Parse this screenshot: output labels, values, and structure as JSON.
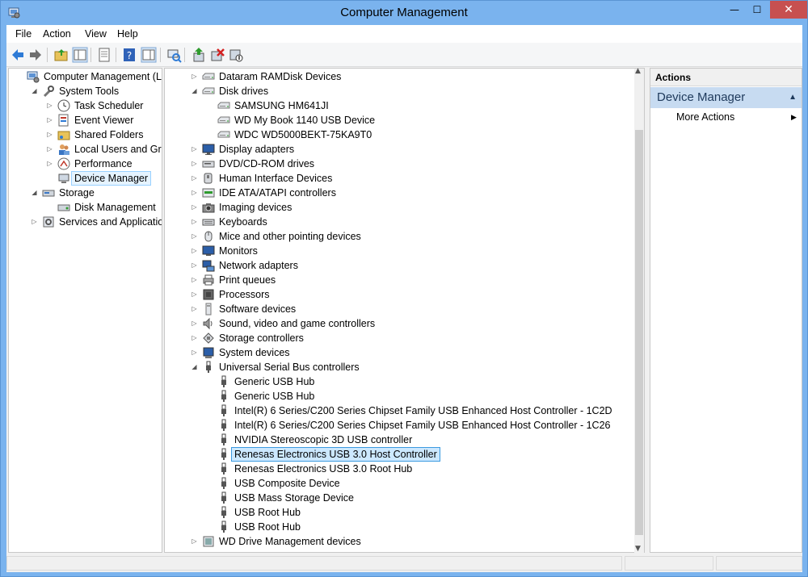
{
  "window": {
    "title": "Computer Management",
    "minimize_glyph": "—",
    "maximize_glyph": "☐",
    "close_glyph": "✕"
  },
  "menu": [
    "File",
    "Action",
    "View",
    "Help"
  ],
  "toolbar_icons": [
    "back-icon",
    "forward-icon",
    "up-folder-icon",
    "show-hide-tree-icon",
    "properties-icon",
    "help-icon",
    "show-hide-action-pane-icon",
    "scan-hardware-icon",
    "update-driver-icon",
    "uninstall-icon",
    "disable-device-icon"
  ],
  "left_tree": [
    {
      "label": "Computer Management (Local",
      "level": 0,
      "arrow": "",
      "icon": "computer-management-icon"
    },
    {
      "label": "System Tools",
      "level": 1,
      "arrow": "expanded",
      "icon": "system-tools-icon"
    },
    {
      "label": "Task Scheduler",
      "level": 2,
      "arrow": "collapsed",
      "icon": "clock-icon"
    },
    {
      "label": "Event Viewer",
      "level": 2,
      "arrow": "collapsed",
      "icon": "event-viewer-icon"
    },
    {
      "label": "Shared Folders",
      "level": 2,
      "arrow": "collapsed",
      "icon": "shared-folder-icon"
    },
    {
      "label": "Local Users and Groups",
      "level": 2,
      "arrow": "collapsed",
      "icon": "users-icon"
    },
    {
      "label": "Performance",
      "level": 2,
      "arrow": "collapsed",
      "icon": "performance-icon"
    },
    {
      "label": "Device Manager",
      "level": 2,
      "arrow": "",
      "icon": "device-manager-icon",
      "selected": true
    },
    {
      "label": "Storage",
      "level": 1,
      "arrow": "expanded",
      "icon": "storage-icon"
    },
    {
      "label": "Disk Management",
      "level": 2,
      "arrow": "",
      "icon": "disk-management-icon"
    },
    {
      "label": "Services and Applications",
      "level": 1,
      "arrow": "collapsed",
      "icon": "services-icon"
    }
  ],
  "device_tree": [
    {
      "label": "Dataram RAMDisk Devices",
      "level": 0,
      "arrow": "collapsed",
      "icon": "disk-icon"
    },
    {
      "label": "Disk drives",
      "level": 0,
      "arrow": "expanded",
      "icon": "disk-icon"
    },
    {
      "label": "SAMSUNG HM641JI",
      "level": 1,
      "arrow": "",
      "icon": "disk-icon"
    },
    {
      "label": "WD My Book 1140 USB Device",
      "level": 1,
      "arrow": "",
      "icon": "disk-icon"
    },
    {
      "label": "WDC WD5000BEKT-75KA9T0",
      "level": 1,
      "arrow": "",
      "icon": "disk-icon"
    },
    {
      "label": "Display adapters",
      "level": 0,
      "arrow": "collapsed",
      "icon": "display-icon"
    },
    {
      "label": "DVD/CD-ROM drives",
      "level": 0,
      "arrow": "collapsed",
      "icon": "dvd-icon"
    },
    {
      "label": "Human Interface Devices",
      "level": 0,
      "arrow": "collapsed",
      "icon": "hid-icon"
    },
    {
      "label": "IDE ATA/ATAPI controllers",
      "level": 0,
      "arrow": "collapsed",
      "icon": "ide-icon"
    },
    {
      "label": "Imaging devices",
      "level": 0,
      "arrow": "collapsed",
      "icon": "camera-icon"
    },
    {
      "label": "Keyboards",
      "level": 0,
      "arrow": "collapsed",
      "icon": "keyboard-icon"
    },
    {
      "label": "Mice and other pointing devices",
      "level": 0,
      "arrow": "collapsed",
      "icon": "mouse-icon"
    },
    {
      "label": "Monitors",
      "level": 0,
      "arrow": "collapsed",
      "icon": "monitor-icon"
    },
    {
      "label": "Network adapters",
      "level": 0,
      "arrow": "collapsed",
      "icon": "network-icon"
    },
    {
      "label": "Print queues",
      "level": 0,
      "arrow": "collapsed",
      "icon": "printer-icon"
    },
    {
      "label": "Processors",
      "level": 0,
      "arrow": "collapsed",
      "icon": "processor-icon"
    },
    {
      "label": "Software devices",
      "level": 0,
      "arrow": "collapsed",
      "icon": "software-device-icon"
    },
    {
      "label": "Sound, video and game controllers",
      "level": 0,
      "arrow": "collapsed",
      "icon": "speaker-icon"
    },
    {
      "label": "Storage controllers",
      "level": 0,
      "arrow": "collapsed",
      "icon": "storage-controller-icon"
    },
    {
      "label": "System devices",
      "level": 0,
      "arrow": "collapsed",
      "icon": "system-device-icon"
    },
    {
      "label": "Universal Serial Bus controllers",
      "level": 0,
      "arrow": "expanded",
      "icon": "usb-icon"
    },
    {
      "label": "Generic USB Hub",
      "level": 1,
      "arrow": "",
      "icon": "usb-icon"
    },
    {
      "label": "Generic USB Hub",
      "level": 1,
      "arrow": "",
      "icon": "usb-icon"
    },
    {
      "label": "Intel(R) 6 Series/C200 Series Chipset Family USB Enhanced Host Controller - 1C2D",
      "level": 1,
      "arrow": "",
      "icon": "usb-icon"
    },
    {
      "label": "Intel(R) 6 Series/C200 Series Chipset Family USB Enhanced Host Controller - 1C26",
      "level": 1,
      "arrow": "",
      "icon": "usb-icon"
    },
    {
      "label": "NVIDIA Stereoscopic 3D USB controller",
      "level": 1,
      "arrow": "",
      "icon": "usb-icon"
    },
    {
      "label": "Renesas Electronics USB 3.0 Host Controller",
      "level": 1,
      "arrow": "",
      "icon": "usb-icon",
      "focused": true
    },
    {
      "label": "Renesas Electronics USB 3.0 Root Hub",
      "level": 1,
      "arrow": "",
      "icon": "usb-icon"
    },
    {
      "label": "USB Composite Device",
      "level": 1,
      "arrow": "",
      "icon": "usb-icon"
    },
    {
      "label": "USB Mass Storage Device",
      "level": 1,
      "arrow": "",
      "icon": "usb-icon"
    },
    {
      "label": "USB Root Hub",
      "level": 1,
      "arrow": "",
      "icon": "usb-icon"
    },
    {
      "label": "USB Root Hub",
      "level": 1,
      "arrow": "",
      "icon": "usb-icon"
    },
    {
      "label": "WD Drive Management devices",
      "level": 0,
      "arrow": "collapsed",
      "icon": "wd-device-icon"
    }
  ],
  "actions": {
    "header": "Actions",
    "section": "Device Manager",
    "items": [
      "More Actions"
    ]
  },
  "colors": {
    "titlebar": "#7ab3ee",
    "close_button": "#c75050",
    "selection": "#cce8ff",
    "actions_section": "#c7dbf1"
  }
}
